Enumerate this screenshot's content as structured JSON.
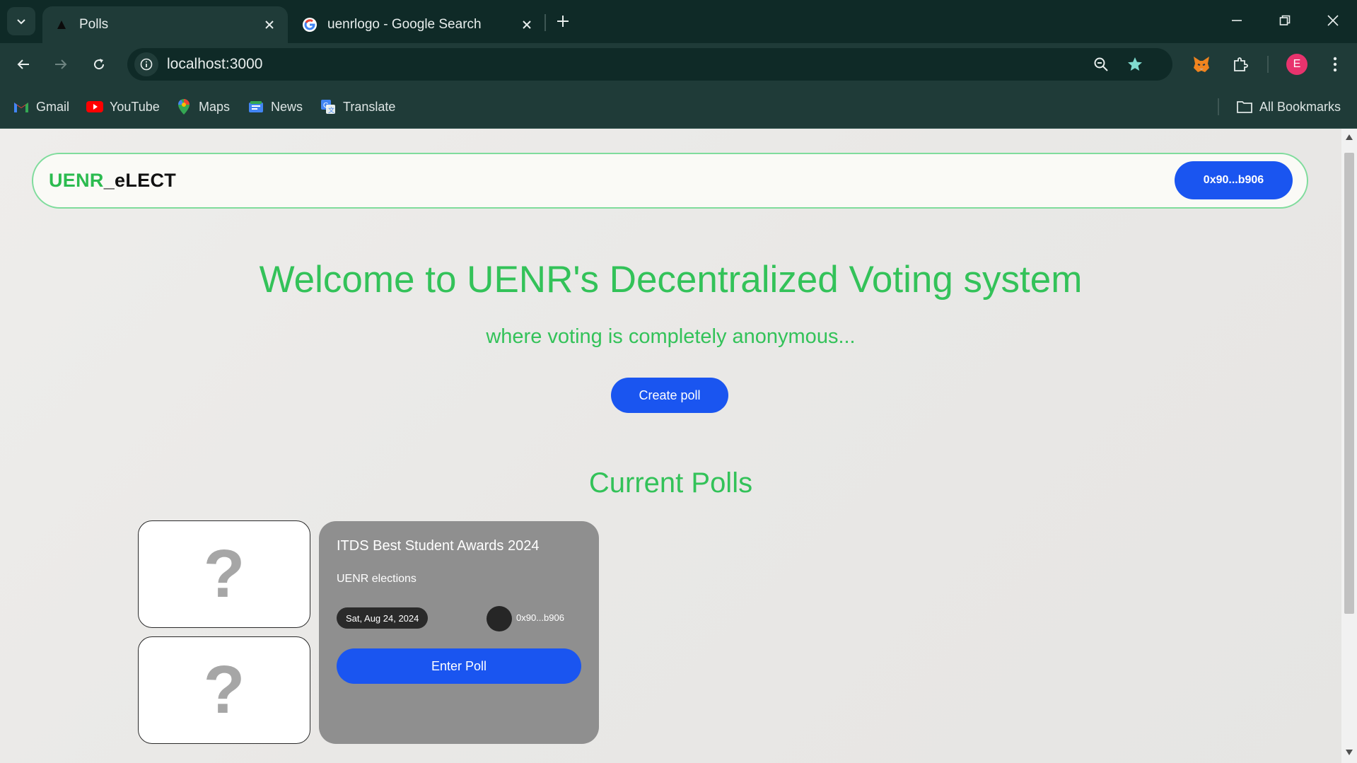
{
  "browser": {
    "tabs": [
      {
        "title": "Polls",
        "active": true
      },
      {
        "title": "uenrlogo - Google Search",
        "active": false
      }
    ],
    "url": "localhost:3000",
    "profile_initial": "E",
    "bookmarks": [
      {
        "label": "Gmail",
        "icon": "gmail-icon"
      },
      {
        "label": "YouTube",
        "icon": "youtube-icon"
      },
      {
        "label": "Maps",
        "icon": "maps-icon"
      },
      {
        "label": "News",
        "icon": "news-icon"
      },
      {
        "label": "Translate",
        "icon": "translate-icon"
      }
    ],
    "all_bookmarks_label": "All Bookmarks"
  },
  "app": {
    "logo_part1": "UENR",
    "logo_part2": "_eLECT",
    "wallet_label": "0x90...b906",
    "hero_title": "Welcome to UENR's Decentralized Voting system",
    "hero_subtitle": "where voting is completely anonymous...",
    "create_poll_label": "Create poll",
    "current_polls_title": "Current Polls",
    "polls": [
      {
        "title": "ITDS Best Student Awards 2024",
        "description": "UENR elections",
        "date": "Sat, Aug 24, 2024",
        "owner": "0x90...b906",
        "enter_label": "Enter Poll",
        "image_placeholders": [
          "?",
          "?"
        ]
      }
    ]
  },
  "colors": {
    "accent_green": "#33c259",
    "primary_blue": "#1a55f0",
    "card_gray": "#8f8f8f"
  }
}
